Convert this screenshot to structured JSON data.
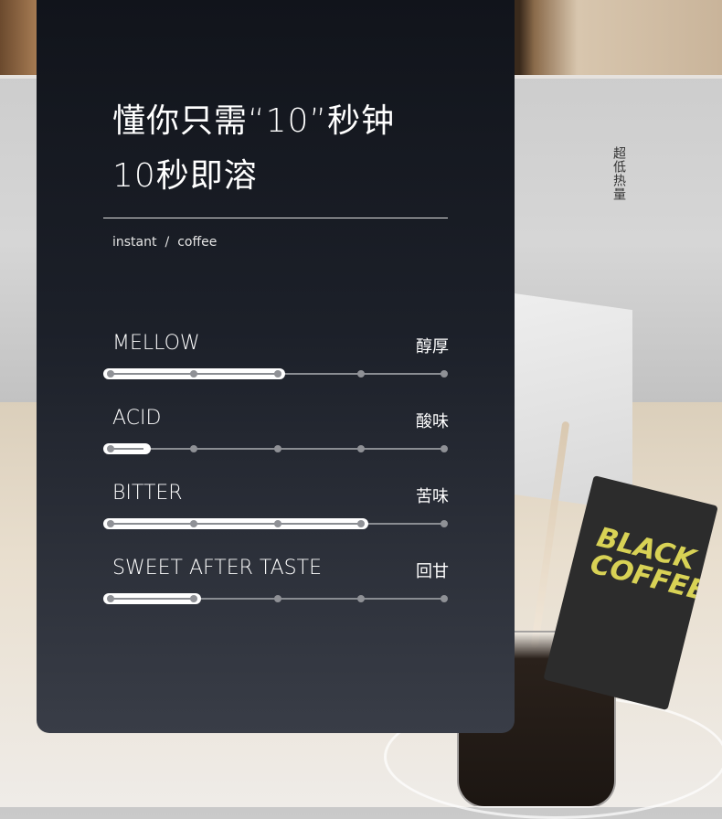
{
  "heading": {
    "line1": "懂你只需“10”秒钟",
    "line2": "10秒即溶"
  },
  "tags": {
    "first": "instant",
    "separator": "/",
    "second": "coffee"
  },
  "side_caption": "超低热量",
  "product_label": "BLACK COFFEE",
  "scale_steps": 5,
  "attributes": [
    {
      "en": "MELLOW",
      "cn": "醇厚",
      "level": 3
    },
    {
      "en": "ACID",
      "cn": "酸味",
      "level": 1
    },
    {
      "en": "BITTER",
      "cn": "苦味",
      "level": 4
    },
    {
      "en": "SWEET AFTER TASTE",
      "cn": "回甘",
      "level": 2
    }
  ],
  "colors": {
    "card_top": "#11141b",
    "card_bottom": "#393d47",
    "fill": "#ffffff",
    "dot": "#8f9196"
  }
}
